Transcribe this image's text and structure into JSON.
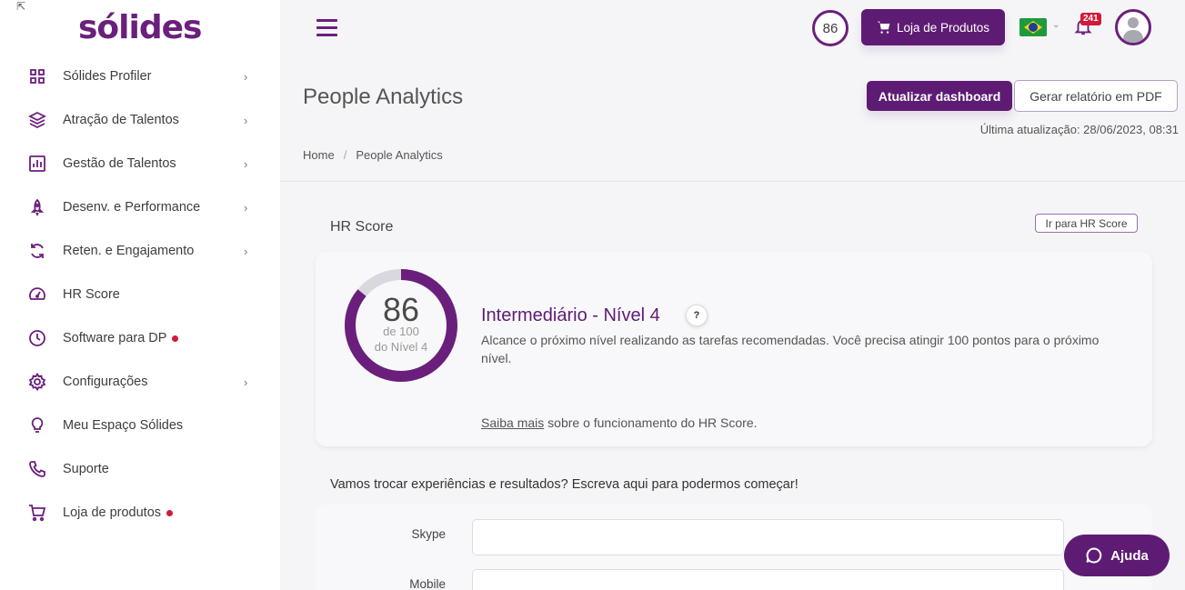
{
  "brand": {
    "logo_text": "sólides",
    "accent": "#5e1b74"
  },
  "sidebar": {
    "items": [
      {
        "label": "Sólides Profiler",
        "icon": "grid-icon",
        "has_chevron": true
      },
      {
        "label": "Atração de Talentos",
        "icon": "layers-icon",
        "has_chevron": true
      },
      {
        "label": "Gestão de Talentos",
        "icon": "bar-chart-icon",
        "has_chevron": true
      },
      {
        "label": "Desenv. e Performance",
        "icon": "rocket-icon",
        "has_chevron": true
      },
      {
        "label": "Reten. e Engajamento",
        "icon": "refresh-icon",
        "has_chevron": true
      },
      {
        "label": "HR Score",
        "icon": "gauge-icon",
        "has_chevron": false
      },
      {
        "label": "Software para DP",
        "icon": "clock-icon",
        "has_chevron": false,
        "dot": true
      },
      {
        "label": "Configurações",
        "icon": "gear-icon",
        "has_chevron": true
      },
      {
        "label": "Meu Espaço Sólides",
        "icon": "lightbulb-icon",
        "has_chevron": false
      },
      {
        "label": "Suporte",
        "icon": "phone-icon",
        "has_chevron": false
      },
      {
        "label": "Loja de produtos",
        "icon": "cart-icon",
        "has_chevron": false,
        "dot": true
      }
    ],
    "chevron": "›"
  },
  "topbar": {
    "score": "86",
    "store_label": "Loja de Produtos",
    "notifications_count": "241",
    "flag_chevron": "⌄"
  },
  "page": {
    "title": "People Analytics",
    "update_button": "Atualizar dashboard",
    "pdf_button": "Gerar relatório em PDF",
    "last_update": "Última atualização: 28/06/2023, 08:31",
    "breadcrumb": {
      "home": "Home",
      "separator": "/",
      "current": "People Analytics"
    }
  },
  "hr_score": {
    "section_title": "HR Score",
    "go_button": "Ir para HR Score",
    "score": "86",
    "score_fraction": 0.86,
    "of_label": "de 100",
    "level_label": "do Nível 4",
    "level_title": "Intermediário - Nível 4",
    "help_symbol": "?",
    "description": "Alcance o próximo nível realizando as tarefas recomendadas. Você precisa atingir 100 pontos para o próximo nível.",
    "learn_more_link": "Saiba mais",
    "learn_more_rest": " sobre o funcionamento do HR Score."
  },
  "contact": {
    "title": "Vamos trocar experiências e resultados? Escreva aqui para podermos começar!",
    "skype_label": "Skype",
    "skype_value": "",
    "mobile_label": "Mobile",
    "mobile_value": ""
  },
  "help_chat": {
    "label": "Ajuda"
  }
}
